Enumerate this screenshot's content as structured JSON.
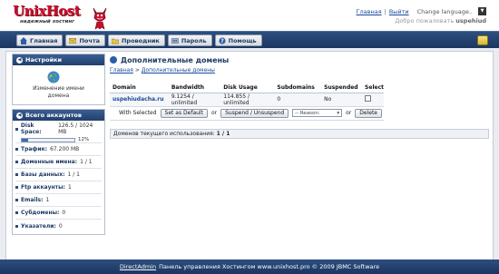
{
  "header": {
    "logo_text": "UnixHost",
    "logo_subtitle": "надежный хостинг",
    "links": {
      "home": "Главная",
      "separator": "|",
      "logout": "Выйти"
    },
    "language_label": "Change language..",
    "welcome_prefix": "Добро пожаловать",
    "username": "uspehiud"
  },
  "nav": {
    "tabs": [
      {
        "label": "Главная",
        "icon": "home-icon"
      },
      {
        "label": "Почта",
        "icon": "mail-icon"
      },
      {
        "label": "Проводник",
        "icon": "folder-icon"
      },
      {
        "label": "Пароль",
        "icon": "password-icon"
      },
      {
        "label": "Помощь",
        "icon": "help-icon"
      }
    ]
  },
  "sidebar": {
    "settings": {
      "title": "Настройки",
      "rename_label_line1": "Изменение имени",
      "rename_label_line2": "домена"
    },
    "account": {
      "title": "Всего аккаунтов",
      "disk_label": "Disk Space:",
      "disk_value": "126.5 / 1024 MB",
      "disk_percent": 12,
      "disk_percent_text": "12%",
      "items": [
        {
          "label": "Трафик:",
          "value": "67.200 MB"
        },
        {
          "label": "Доменные имена:",
          "value": "1 / 1"
        },
        {
          "label": "Базы данных:",
          "value": "1 / 1"
        },
        {
          "label": "Ftp аккаунты:",
          "value": "1"
        },
        {
          "label": "Emails:",
          "value": "1"
        },
        {
          "label": "Субдомены:",
          "value": "0"
        },
        {
          "label": "Указатели:",
          "value": "0"
        }
      ]
    }
  },
  "content": {
    "title": "Дополнительные домены",
    "breadcrumb": {
      "home": "Главная",
      "separator": ">",
      "current": "Дополнительные домены"
    },
    "table": {
      "headers": [
        "Domain",
        "Bandwidth",
        "Disk Usage",
        "Subdomains",
        "Suspended",
        "Select"
      ],
      "rows": [
        {
          "domain": "uspehiudacha.ru",
          "bandwidth": "9.1254 / unlimited",
          "disk": "114.855 / unlimited",
          "subdomains": "0",
          "suspended": "No"
        }
      ]
    },
    "actions": {
      "with_selected": "With Selected",
      "set_default": "Set as Default",
      "or1": "or",
      "suspend": "Suspend / Unsuspend",
      "reason_placeholder": "-- Reason:",
      "or2": "or",
      "delete": "Delete"
    },
    "usage_text": "Доменов текущего использования:",
    "usage_value": "1 / 1"
  },
  "footer": {
    "link": "DirectAdmin",
    "text": "Панель управления Хостингом www.unixhost.pro © 2009 JBMC Software"
  }
}
